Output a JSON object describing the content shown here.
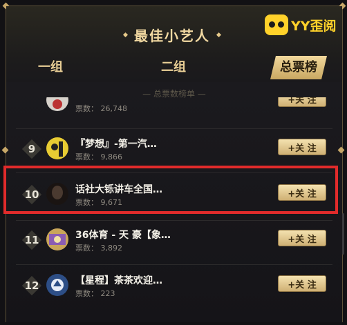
{
  "header": {
    "title": "最佳小艺人",
    "logo_text": "YY歪阅"
  },
  "tabs": [
    {
      "label": "一组",
      "active": false
    },
    {
      "label": "二组",
      "active": false
    },
    {
      "label": "总票榜",
      "active": true
    }
  ],
  "list_title": "— 总票数榜单 —",
  "rows": [
    {
      "rank": "",
      "name": "",
      "votes": "票数： 26,748",
      "follow": "+关 注",
      "avatar_color": "#d7d2cb"
    },
    {
      "rank": "9",
      "name": "『梦想』-第一汽…",
      "votes": "票数： 9,866",
      "follow": "+关 注",
      "avatar_color": "#e8cc33"
    },
    {
      "rank": "10",
      "name": "话社大铄讲车全国…",
      "votes": "票数： 9,671",
      "follow": "+关 注",
      "avatar_color": "#4a3a30"
    },
    {
      "rank": "11",
      "name": "36体育 - 天 豪【象…",
      "votes": "票数： 3,892",
      "follow": "+关 注",
      "avatar_color": "#c9a65a"
    },
    {
      "rank": "12",
      "name": "【星程】茶茶欢迎…",
      "votes": "票数： 223",
      "follow": "+关 注",
      "avatar_color": "#2d4e86"
    }
  ],
  "colors": {
    "accent_gold": "#f2d9a2",
    "highlight_red": "#e12b2b"
  }
}
